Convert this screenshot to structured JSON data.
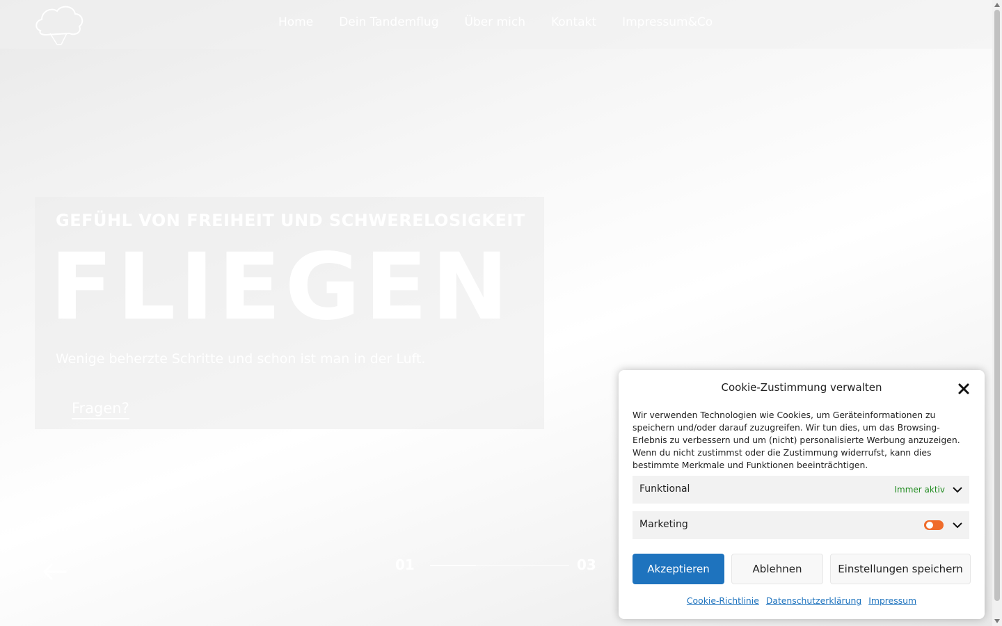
{
  "nav": {
    "items": [
      "Home",
      "Dein Tandemflug",
      "Über mich",
      "Kontakt",
      "Impressum&Co"
    ]
  },
  "hero": {
    "subtitle": "GEFÜHL VON FREIHEIT UND SCHWERELOSIGKEIT",
    "title": "FLIEGEN",
    "text": "Wenige beherzte Schritte und schon ist man in der Luft.",
    "cta": "Fragen?"
  },
  "slider": {
    "current": "01",
    "total": "03",
    "progress": 0.33
  },
  "cookie": {
    "title": "Cookie-Zustimmung verwalten",
    "text": "Wir verwenden Technologien wie Cookies, um Geräteinformationen zu speichern und/oder darauf zuzugreifen. Wir tun dies, um das Browsing-Erlebnis zu verbessern und um (nicht) personalisierte Werbung anzuzeigen. Wenn du nicht zustimmst oder die Zustimmung widerrufst, kann dies bestimmte Merkmale und Funktionen beeinträchtigen.",
    "categories": [
      {
        "label": "Funktional",
        "status": "Immer aktiv"
      },
      {
        "label": "Marketing",
        "enabled": false
      }
    ],
    "buttons": {
      "accept": "Akzeptieren",
      "deny": "Ablehnen",
      "save": "Einstellungen speichern"
    },
    "links": [
      "Cookie-Richtlinie",
      "Datenschutzerklärung",
      "Impressum"
    ]
  },
  "colors": {
    "accent": "#1e73be",
    "toggle": "#ef6b2a",
    "status": "#1e8a1e"
  },
  "icons": {
    "logo": "cloud-paraglider-logo",
    "prev": "arrow-left-icon",
    "close": "close-icon",
    "chevron": "chevron-down-icon"
  }
}
